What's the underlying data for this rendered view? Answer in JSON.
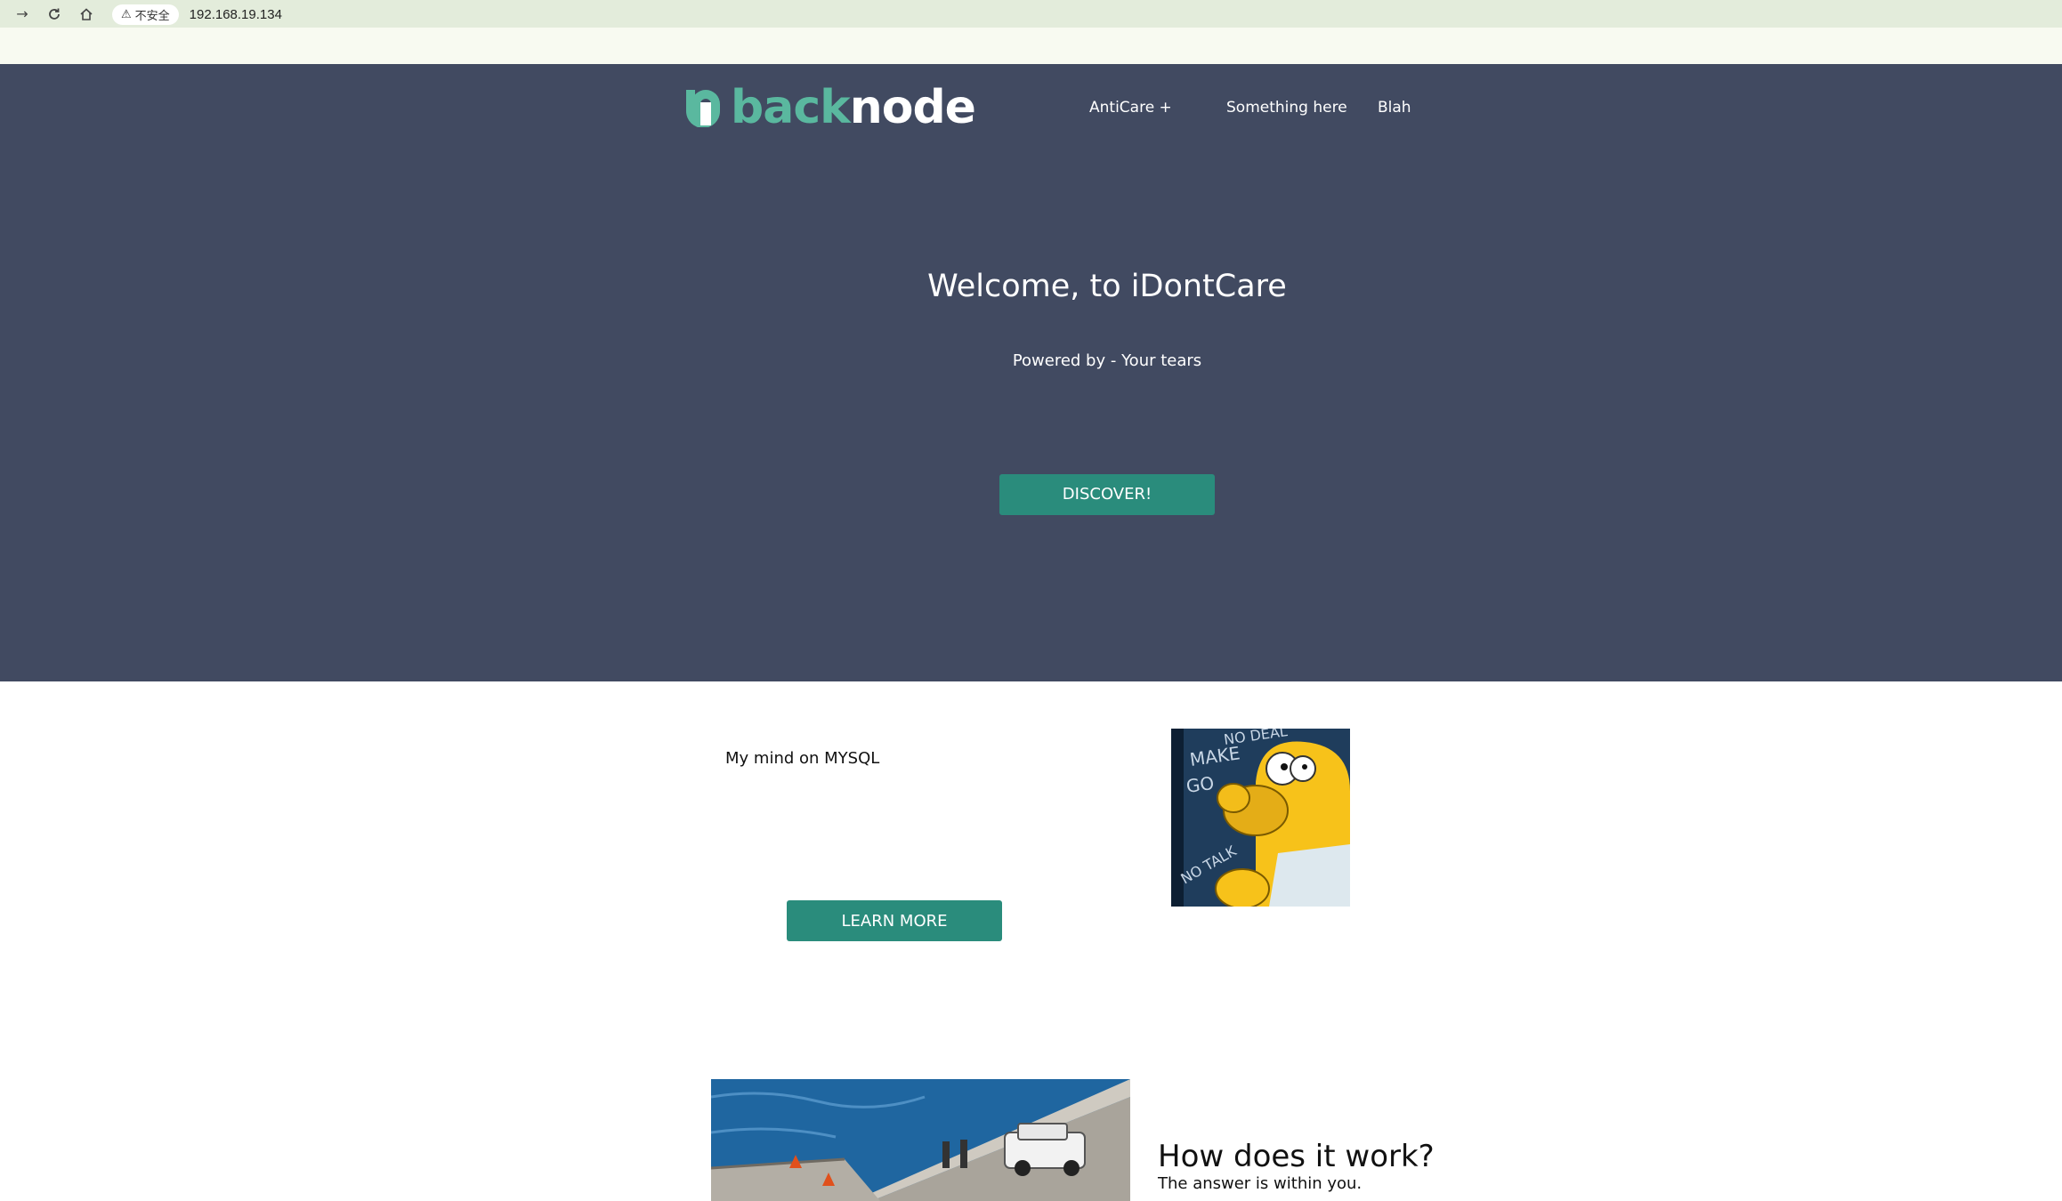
{
  "browser": {
    "security_label": "不安全",
    "url": "192.168.19.134"
  },
  "brand": {
    "logo_part1": "back",
    "logo_part2": "node"
  },
  "nav": {
    "items": [
      "AntiCare +",
      "Something here",
      "Blah"
    ]
  },
  "hero": {
    "title": "Welcome, to iDontCare",
    "subtitle": "Powered by - Your tears",
    "button_label": "DISCOVER!"
  },
  "feature1": {
    "text": "My mind on MYSQL",
    "button_label": "LEARN MORE",
    "image_text": [
      "NO DEAL",
      "MAKE",
      "GO",
      "NO TALK"
    ]
  },
  "feature2": {
    "title": "How does it work?",
    "subtitle": "The answer is within you."
  },
  "colors": {
    "hero_bg": "#414a61",
    "accent": "#2a8c7c",
    "logo_green": "#5ab89f"
  },
  "icons": [
    "forward-icon",
    "reload-icon",
    "home-icon",
    "warning-icon",
    "logo-mark-icon"
  ]
}
